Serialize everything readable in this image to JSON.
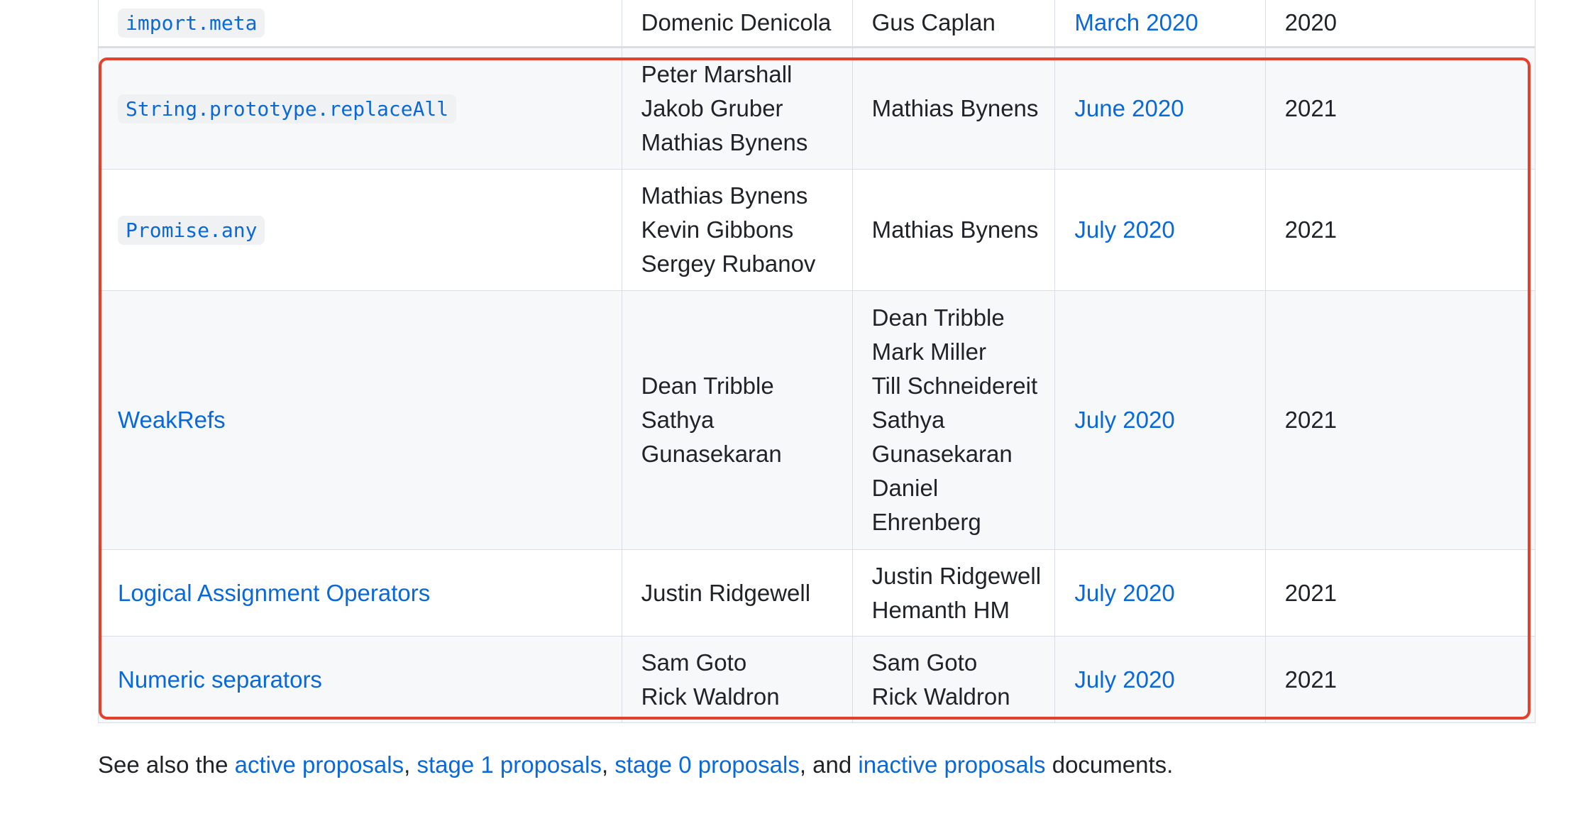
{
  "colors": {
    "link": "#0969da",
    "text": "#1f2328",
    "border": "#d8dee4",
    "row_alt": "#f6f8fa",
    "code_bg": "#eff1f3",
    "highlight": "#e5402e"
  },
  "rows": [
    {
      "proposal": "import.meta",
      "proposal_is_code": true,
      "authors": [
        "Domenic Denicola"
      ],
      "champions": [
        "Gus Caplan"
      ],
      "meeting": "March 2020",
      "year": "2020"
    },
    {
      "proposal": "String.prototype.replaceAll",
      "proposal_is_code": true,
      "authors": [
        "Peter Marshall",
        "Jakob Gruber",
        "Mathias Bynens"
      ],
      "champions": [
        "Mathias Bynens"
      ],
      "meeting": "June 2020",
      "year": "2021"
    },
    {
      "proposal": "Promise.any",
      "proposal_is_code": true,
      "authors": [
        "Mathias Bynens",
        "Kevin Gibbons",
        "Sergey Rubanov"
      ],
      "champions": [
        "Mathias Bynens"
      ],
      "meeting": "July 2020",
      "year": "2021"
    },
    {
      "proposal": "WeakRefs",
      "proposal_is_code": false,
      "authors": [
        "Dean Tribble",
        "Sathya",
        "Gunasekaran"
      ],
      "champions": [
        "Dean Tribble",
        "Mark Miller",
        "Till Schneidereit",
        "Sathya",
        "Gunasekaran",
        "Daniel",
        "Ehrenberg"
      ],
      "meeting": "July 2020",
      "year": "2021"
    },
    {
      "proposal": "Logical Assignment Operators",
      "proposal_is_code": false,
      "authors": [
        "Justin Ridgewell"
      ],
      "champions": [
        "Justin Ridgewell",
        "Hemanth HM"
      ],
      "meeting": "July 2020",
      "year": "2021"
    },
    {
      "proposal": "Numeric separators",
      "proposal_is_code": false,
      "authors": [
        "Sam Goto",
        "Rick Waldron"
      ],
      "champions": [
        "Sam Goto",
        "Rick Waldron"
      ],
      "meeting": "July 2020",
      "year": "2021"
    }
  ],
  "see_also": {
    "prefix": "See also the ",
    "active_link": "active proposals",
    "sep1": ", ",
    "stage1_link": "stage 1 proposals",
    "sep2": ", ",
    "stage0_link": "stage 0 proposals",
    "sep3": ", and ",
    "inactive_link": "inactive proposals",
    "suffix": " documents."
  }
}
